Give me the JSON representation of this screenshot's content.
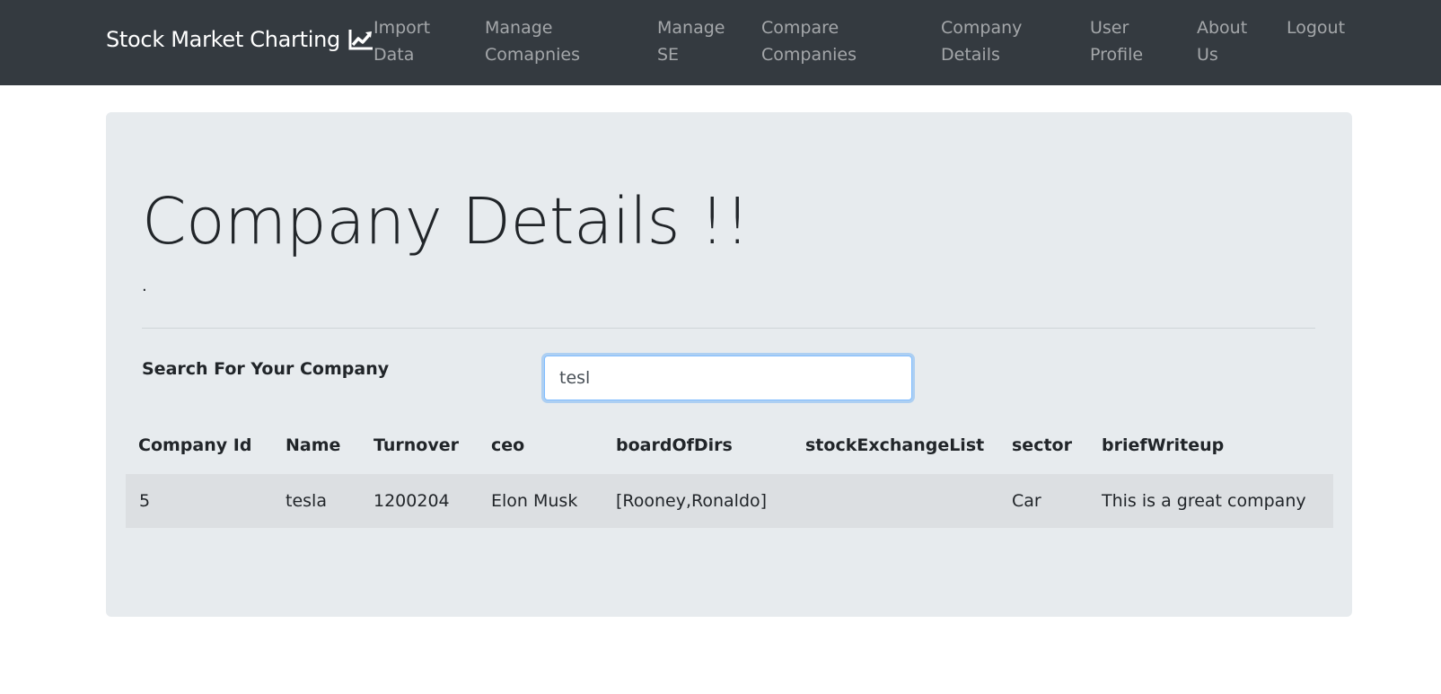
{
  "navbar": {
    "brand": "Stock Market Charting",
    "brand_icon": "line-chart-icon",
    "items": [
      {
        "label": "Import\nData"
      },
      {
        "label": "Manage\nComapnies"
      },
      {
        "label": "Manage\nSE"
      },
      {
        "label": "Compare\nCompanies"
      },
      {
        "label": "Company\nDetails"
      },
      {
        "label": "User\nProfile"
      },
      {
        "label": "About\nUs"
      },
      {
        "label": "Logout"
      }
    ]
  },
  "page": {
    "title": "Company Details !!",
    "lead": "."
  },
  "search": {
    "label": "Search For Your Company",
    "value": "tesl"
  },
  "table": {
    "headers": [
      "Company Id",
      "Name",
      "Turnover",
      "ceo",
      "boardOfDirs",
      "stockExchangeList",
      "sector",
      "briefWriteup"
    ],
    "rows": [
      [
        "5",
        "tesla",
        "1200204",
        "Elon Musk",
        "[Rooney,Ronaldo]",
        "",
        "Car",
        "This is a great company"
      ]
    ]
  },
  "colors": {
    "navbar_bg": "#343a40",
    "jumbotron_bg": "#e7ebee",
    "row_bg": "#dcdfe2",
    "input_focus": "#80bdff"
  }
}
